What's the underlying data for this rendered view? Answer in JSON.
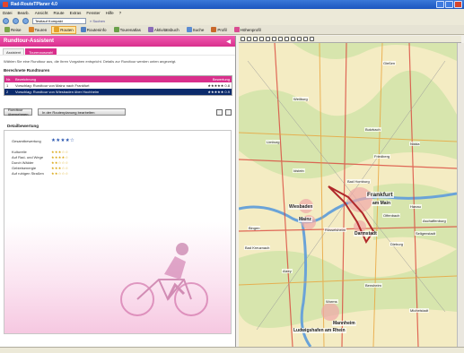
{
  "window": {
    "title": "Rad-RouteTPlaner 4.0"
  },
  "menu": [
    "Datei",
    "Bearb.",
    "Ansicht",
    "Route",
    "Extras",
    "Fenster",
    "Hilfe",
    "?"
  ],
  "address": {
    "combo_value": "Testlauf Kompakt",
    "link": "» Suchen"
  },
  "toolbar": [
    {
      "label": "Reise",
      "color": "#7aa64a",
      "active": false
    },
    {
      "label": "Touren",
      "color": "#d9822b",
      "active": false
    },
    {
      "label": "Routen",
      "color": "#e2a32a",
      "active": true
    },
    {
      "label": "Routeninfo",
      "color": "#4f7fc1",
      "active": false
    },
    {
      "label": "Tourenatlas",
      "color": "#6aa14a",
      "active": false
    },
    {
      "label": "Aktivitätsbuch",
      "color": "#8a6bb8",
      "active": false
    },
    {
      "label": "Suche",
      "color": "#5b8cd1",
      "active": false
    },
    {
      "label": "Profil",
      "color": "#c9682b",
      "active": false
    },
    {
      "label": "Höhenprofil",
      "color": "#d94c91",
      "active": false
    }
  ],
  "assistant": {
    "title": "Rundtour-Assistent",
    "tabs": [
      "Assistent",
      "Tourenauswahl"
    ],
    "description": "Wählen Sie eine Rundtour aus, die Ihren Vorgaben entspricht. Details zur Rundtour werden unten angezeigt.",
    "routes_section": "Berechnete Rundtouren",
    "table_headers": {
      "nr": "Nr.",
      "name": "Bezeichnung",
      "rating": "Bewertung"
    },
    "routes": [
      {
        "nr": "1",
        "name": "Vorschlag: Rundtour von Mainz nach Frankfurt",
        "rating": "★★★★★  0.8",
        "selected": false
      },
      {
        "nr": "2",
        "name": "Vorschlag: Rundtour von Wiesbaden über Hochheim",
        "rating": "★★★★★  0.9",
        "selected": true
      }
    ],
    "buttons": {
      "show": "Rundtour übernehmen",
      "edit": "In der Routenplanung bearbeiten"
    },
    "details_title": "Detailbewertung",
    "ratings": [
      {
        "label": "Gesamtbewertung",
        "stars": "★★★★☆",
        "overall": true
      },
      {
        "label": "Kulturelle",
        "stars": "★★★☆☆",
        "overall": false
      },
      {
        "label": "Auf Rad- und Wege",
        "stars": "★★★★☆",
        "overall": false
      },
      {
        "label": "Durch Wälder",
        "stars": "★★☆☆☆",
        "overall": false
      },
      {
        "label": "Gebietsenergie",
        "stars": "★★★☆☆",
        "overall": false
      },
      {
        "label": "Auf ruhigen Straßen",
        "stars": "★★☆☆☆",
        "overall": false
      }
    ]
  },
  "map": {
    "labels": [
      {
        "text": "Frankfurt",
        "cls": "big"
      },
      {
        "text": "am Main",
        "cls": "mid"
      },
      {
        "text": "Wiesbaden",
        "cls": "mid"
      },
      {
        "text": "Mainz",
        "cls": "mid"
      },
      {
        "text": "Darmstadt",
        "cls": "mid"
      },
      {
        "text": "Ludwigshafen am Rhein",
        "cls": "mid"
      },
      {
        "text": "Mannheim",
        "cls": "mid"
      },
      {
        "text": "Bad Homburg",
        "cls": ""
      },
      {
        "text": "Friedberg",
        "cls": ""
      },
      {
        "text": "Hanau",
        "cls": ""
      },
      {
        "text": "Offenbach",
        "cls": ""
      },
      {
        "text": "Limburg",
        "cls": ""
      },
      {
        "text": "Butzbach",
        "cls": ""
      },
      {
        "text": "Rüsselsheim",
        "cls": ""
      },
      {
        "text": "Alzey",
        "cls": ""
      },
      {
        "text": "Worms",
        "cls": ""
      },
      {
        "text": "Bensheim",
        "cls": ""
      },
      {
        "text": "Dieburg",
        "cls": ""
      },
      {
        "text": "Aschaffenburg",
        "cls": ""
      },
      {
        "text": "Bad Kreuznach",
        "cls": ""
      },
      {
        "text": "Nidda",
        "cls": ""
      },
      {
        "text": "Gießen",
        "cls": ""
      },
      {
        "text": "Bingen",
        "cls": ""
      },
      {
        "text": "Idstein",
        "cls": ""
      },
      {
        "text": "Weilburg",
        "cls": ""
      },
      {
        "text": "Seligenstadt",
        "cls": ""
      },
      {
        "text": "Michelstadt",
        "cls": ""
      }
    ]
  }
}
